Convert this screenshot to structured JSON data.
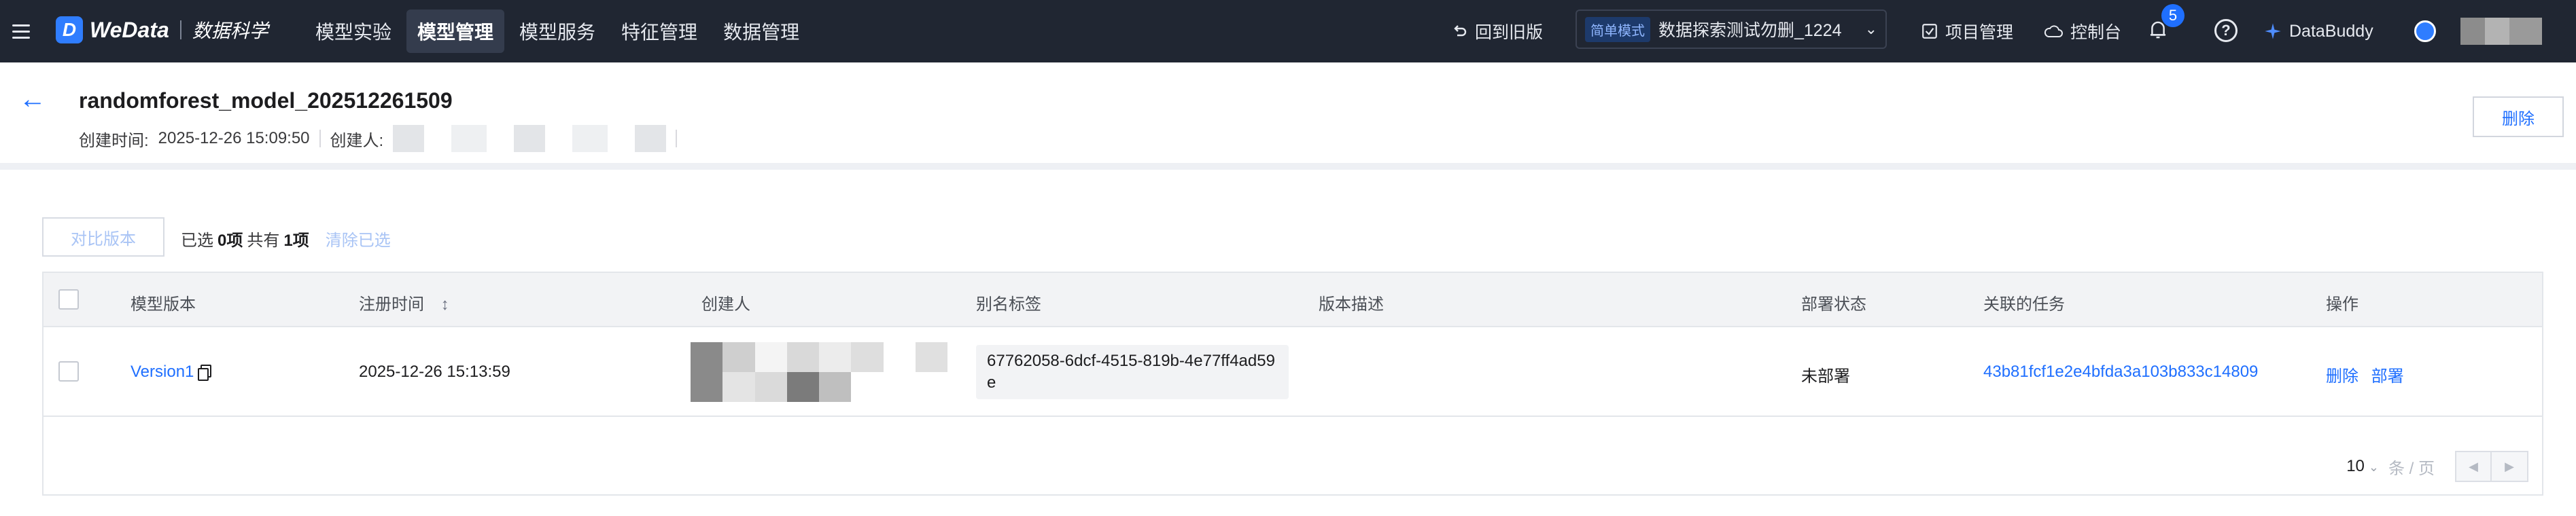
{
  "topbar": {
    "logo_text": "WeData",
    "product": "数据科学",
    "nav": [
      "模型实验",
      "模型管理",
      "模型服务",
      "特征管理",
      "数据管理"
    ],
    "active_nav": "模型管理",
    "back_old": "回到旧版",
    "mode_badge": "简单模式",
    "project_name": "数据探索测试勿删_1224",
    "project_mgmt": "项目管理",
    "console": "控制台",
    "notifications": "5",
    "buddy": "DataBuddy"
  },
  "header": {
    "title": "randomforest_model_202512261509",
    "created_time_label": "创建时间:",
    "created_time": "2025-12-26 15:09:50",
    "creator_label": "创建人:",
    "delete_label": "删除"
  },
  "toolbar": {
    "compare_label": "对比版本",
    "selected_prefix": "已选",
    "selected_count": "0项",
    "total_prefix": "共有",
    "total_count": "1项",
    "clear_label": "清除已选"
  },
  "table": {
    "columns": [
      "模型版本",
      "注册时间",
      "创建人",
      "别名标签",
      "版本描述",
      "部署状态",
      "关联的任务",
      "操作"
    ],
    "rows": [
      {
        "version": "Version1",
        "registered_at": "2025-12-26 15:13:59",
        "alias": "67762058-6dcf-4515-819b-4e77ff4ad59e",
        "description": "",
        "deploy_status": "未部署",
        "task": "43b81fcf1e2e4bfda3a103b833c14809",
        "action_delete": "删除",
        "action_deploy": "部署"
      }
    ]
  },
  "pager": {
    "page_size": "10",
    "unit": "条 / 页"
  }
}
